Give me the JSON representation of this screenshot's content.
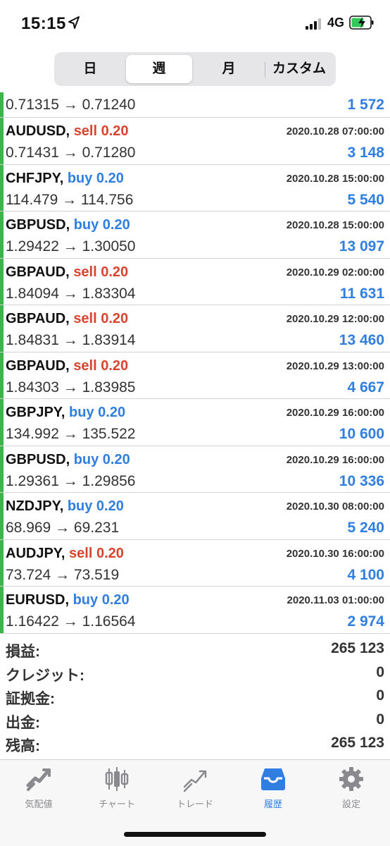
{
  "status_bar": {
    "time": "15:15",
    "network": "4G"
  },
  "segments": [
    {
      "label": "日"
    },
    {
      "label": "週"
    },
    {
      "label": "月"
    },
    {
      "label": "カスタム"
    }
  ],
  "first_row": {
    "prices": "0.71315 → 0.71240",
    "profit": "1 572"
  },
  "deals": [
    {
      "symbol": "AUDUSD,",
      "side": "sell 0.20",
      "date": "2020.10.28 07:00:00",
      "prices": "0.71431 → 0.71280",
      "profit": "3 148"
    },
    {
      "symbol": "CHFJPY,",
      "side": "buy 0.20",
      "date": "2020.10.28 15:00:00",
      "prices": "114.479 → 114.756",
      "profit": "5 540"
    },
    {
      "symbol": "GBPUSD,",
      "side": "buy 0.20",
      "date": "2020.10.28 15:00:00",
      "prices": "1.29422 → 1.30050",
      "profit": "13 097"
    },
    {
      "symbol": "GBPAUD,",
      "side": "sell 0.20",
      "date": "2020.10.29 02:00:00",
      "prices": "1.84094 → 1.83304",
      "profit": "11 631"
    },
    {
      "symbol": "GBPAUD,",
      "side": "sell 0.20",
      "date": "2020.10.29 12:00:00",
      "prices": "1.84831 → 1.83914",
      "profit": "13 460"
    },
    {
      "symbol": "GBPAUD,",
      "side": "sell 0.20",
      "date": "2020.10.29 13:00:00",
      "prices": "1.84303 → 1.83985",
      "profit": "4 667"
    },
    {
      "symbol": "GBPJPY,",
      "side": "buy 0.20",
      "date": "2020.10.29 16:00:00",
      "prices": "134.992 → 135.522",
      "profit": "10 600"
    },
    {
      "symbol": "GBPUSD,",
      "side": "buy 0.20",
      "date": "2020.10.29 16:00:00",
      "prices": "1.29361 → 1.29856",
      "profit": "10 336"
    },
    {
      "symbol": "NZDJPY,",
      "side": "buy 0.20",
      "date": "2020.10.30 08:00:00",
      "prices": "68.969 → 69.231",
      "profit": "5 240"
    },
    {
      "symbol": "AUDJPY,",
      "side": "sell 0.20",
      "date": "2020.10.30 16:00:00",
      "prices": "73.724 → 73.519",
      "profit": "4 100"
    },
    {
      "symbol": "EURUSD,",
      "side": "buy 0.20",
      "date": "2020.11.03 01:00:00",
      "prices": "1.16422 → 1.16564",
      "profit": "2 974"
    }
  ],
  "summary": [
    {
      "label": "損益:",
      "value": "265 123"
    },
    {
      "label": "クレジット:",
      "value": "0"
    },
    {
      "label": "証拠金:",
      "value": "0"
    },
    {
      "label": "出金:",
      "value": "0"
    },
    {
      "label": "残高:",
      "value": "265 123"
    }
  ],
  "tabs": [
    {
      "label": "気配値",
      "icon": "quotes-icon"
    },
    {
      "label": "チャート",
      "icon": "chart-icon"
    },
    {
      "label": "トレード",
      "icon": "trade-icon"
    },
    {
      "label": "履歴",
      "icon": "history-icon"
    },
    {
      "label": "設定",
      "icon": "settings-icon"
    }
  ],
  "colors": {
    "sell": "#d9442d",
    "buy": "#2f7ee0",
    "profit": "#2f7ee0",
    "row_marker": "#39b54a",
    "tab_active": "#2f7ee0",
    "tab_inactive": "#8a8a8e"
  }
}
